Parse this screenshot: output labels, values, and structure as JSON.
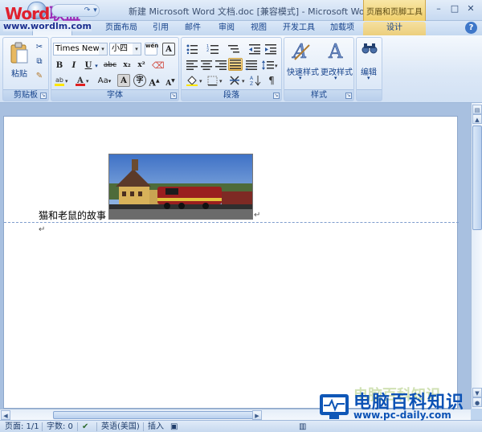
{
  "titlebar": {
    "logo_part1": "Word",
    "logo_part2": "联盟",
    "window_title": "新建 Microsoft Word 文档.doc [兼容模式] - Microsoft Word",
    "context_tab_group": "页眉和页脚工具",
    "minimize": "–",
    "maximize": "□",
    "close": "✕"
  },
  "tabs": {
    "logo_url": "www.wordlm.com",
    "items": [
      "页面布局",
      "引用",
      "邮件",
      "审阅",
      "视图",
      "开发工具",
      "加载项"
    ],
    "context_tab": "设计"
  },
  "ribbon": {
    "clipboard": {
      "label": "剪贴板",
      "paste": "粘贴"
    },
    "font": {
      "label": "字体",
      "font_name": "Times New R",
      "font_size": "小四",
      "bold": "B",
      "italic": "I",
      "underline": "U",
      "strike": "abc",
      "subscript": "x₂",
      "superscript": "x²",
      "case": "Aa",
      "grow": "A",
      "shrink": "A",
      "phonetic": "wén",
      "border_char": "A"
    },
    "paragraph": {
      "label": "段落"
    },
    "styles": {
      "label": "样式",
      "quick_styles": "快速样式",
      "change_styles": "更改样式"
    },
    "editing": {
      "label": "编辑",
      "edit": "编辑"
    }
  },
  "document": {
    "body_text": "猫和老鼠的故事",
    "para_mark": "↵"
  },
  "statusbar": {
    "page": "页面: 1/1",
    "words": "字数: 0",
    "language": "英语(美国)",
    "insert": "插入"
  },
  "watermark": {
    "main": "电脑百科知识",
    "url": "www.pc-daily.com",
    "faint": "电脑百科知识"
  },
  "colors": {
    "ribbon_blue": "#15428b",
    "context_gold": "#f0cf6a",
    "watermark_blue": "#0c52b5"
  }
}
